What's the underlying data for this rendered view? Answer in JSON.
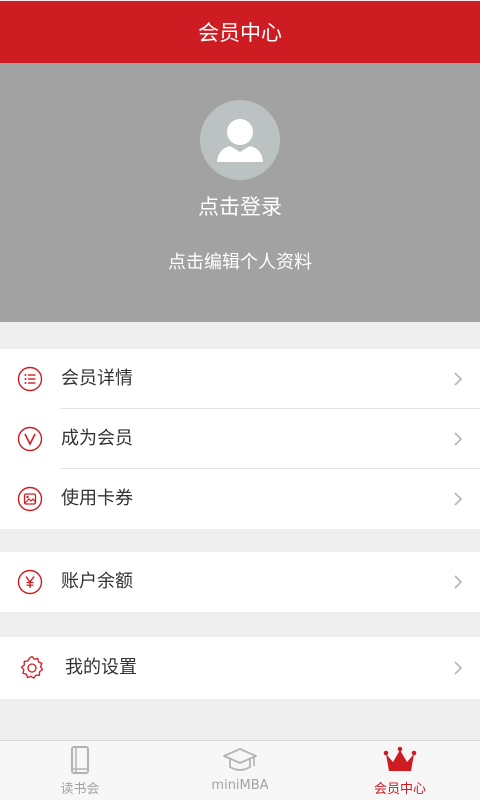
{
  "header": {
    "title": "会员中心"
  },
  "profile": {
    "login_label": "点击登录",
    "edit_label": "点击编辑个人资料"
  },
  "menu": {
    "group1": [
      {
        "label": "会员详情",
        "icon": "list-circle-icon"
      },
      {
        "label": "成为会员",
        "icon": "vip-v-icon"
      },
      {
        "label": "使用卡券",
        "icon": "coupon-icon"
      }
    ],
    "group2": [
      {
        "label": "账户余额",
        "icon": "yen-icon"
      }
    ],
    "group3": [
      {
        "label": "我的设置",
        "icon": "gear-icon"
      }
    ]
  },
  "tabbar": {
    "items": [
      {
        "label": "读书会",
        "icon": "book-icon",
        "active": false
      },
      {
        "label": "miniMBA",
        "icon": "graduation-cap-icon",
        "active": false
      },
      {
        "label": "会员中心",
        "icon": "crown-icon",
        "active": true
      }
    ]
  },
  "colors": {
    "accent": "#cd1c22",
    "profile_bg": "#a2a2a2",
    "page_bg": "#efefef"
  }
}
